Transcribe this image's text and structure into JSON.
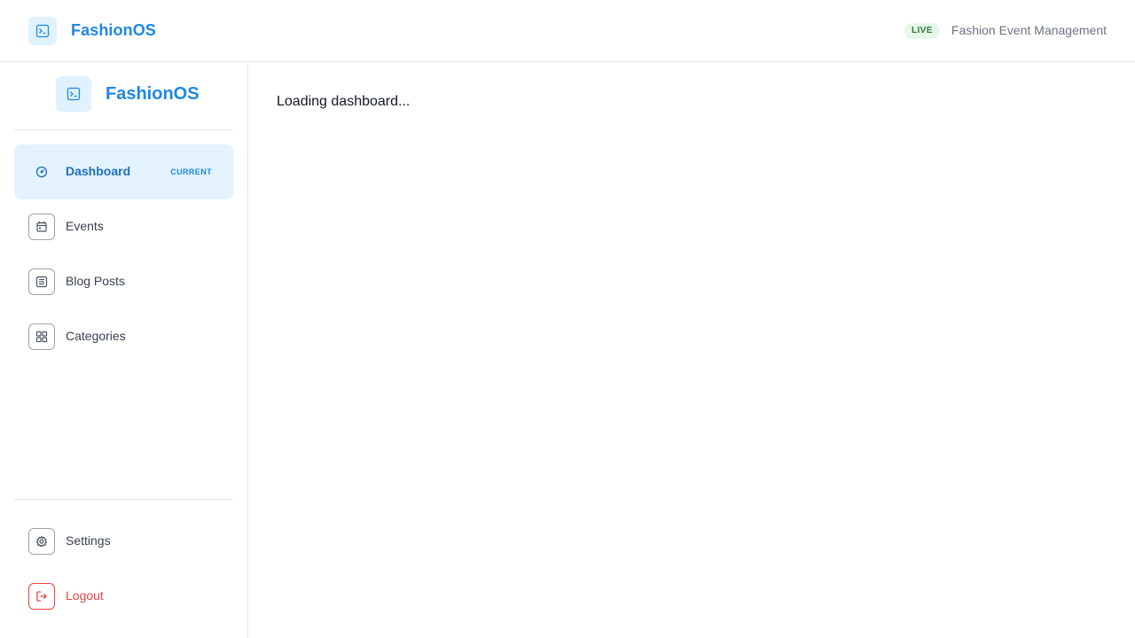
{
  "header": {
    "brand_name": "FashionOS",
    "brand_icon": "terminal-icon",
    "status_badge": "LIVE",
    "subtitle": "Fashion Event Management"
  },
  "sidebar": {
    "brand_name": "FashionOS",
    "brand_icon": "terminal-icon",
    "items": [
      {
        "label": "Dashboard",
        "icon": "gauge-icon",
        "active": true,
        "badge": "CURRENT"
      },
      {
        "label": "Events",
        "icon": "calendar-icon",
        "active": false
      },
      {
        "label": "Blog Posts",
        "icon": "document-icon",
        "active": false
      },
      {
        "label": "Categories",
        "icon": "grid-icon",
        "active": false
      }
    ],
    "footer_items": [
      {
        "label": "Settings",
        "icon": "gear-icon"
      },
      {
        "label": "Logout",
        "icon": "logout-icon"
      }
    ]
  },
  "main": {
    "loading_text": "Loading dashboard..."
  },
  "colors": {
    "accent": "#1e88e5",
    "active_bg": "#e3f2fd",
    "live_green": "#2e7d32",
    "danger": "#ef4444"
  }
}
